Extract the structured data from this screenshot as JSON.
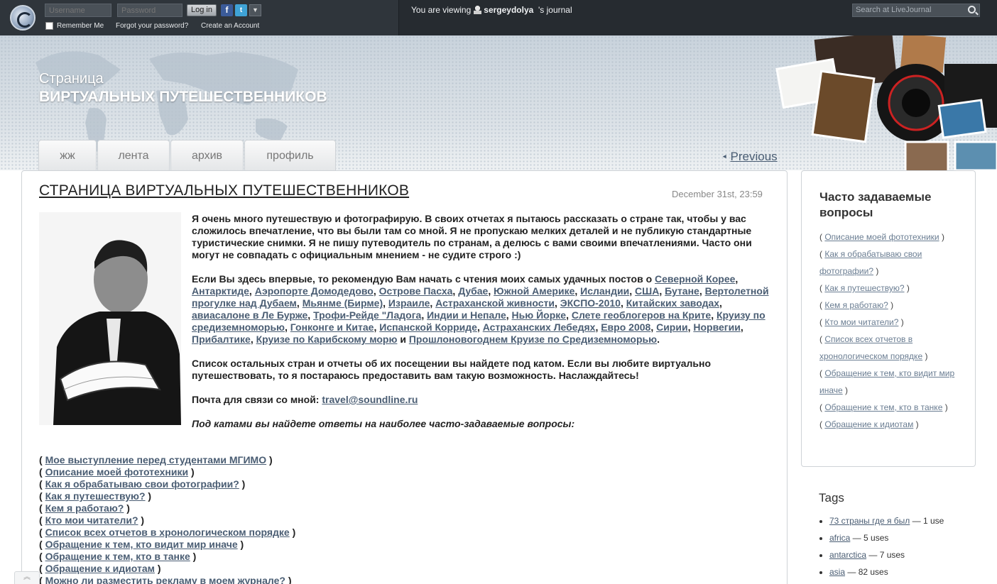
{
  "topbar": {
    "username_placeholder": "Username",
    "password_placeholder": "Password",
    "login_label": "Log in",
    "remember_label": "Remember Me",
    "forgot_label": "Forgot your password?",
    "create_label": "Create an Account",
    "viewing_prefix": "You are viewing",
    "viewing_user": "sergeydolya",
    "viewing_suffix": "'s journal",
    "search_placeholder": "Search at LiveJournal"
  },
  "header": {
    "title_line1": "Страница",
    "title_line2": "ВИРТУАЛЬНЫХ ПУТЕШЕСТВЕННИКОВ"
  },
  "nav": {
    "tabs": [
      "жж",
      "лента",
      "архив",
      "профиль"
    ],
    "previous": "Previous"
  },
  "post": {
    "title": "СТРАНИЦА ВИРТУАЛЬНЫХ ПУТЕШЕСТВЕННИКОВ",
    "date": "December 31st, 23:59",
    "p1": "Я очень много путешествую и фотографирую. В своих отчетах я пытаюсь рассказать о стране так, чтобы у вас сложилось впечатление, что вы были там со мной. Я не пропускаю мелких деталей и не публикую стандартные туристические снимки. Я не пишу путеводитель по странам, а делюсь с вами своими впечатлениями. Часто они могут не совпадать с официальным мнением - не судите строго :)",
    "p2_intro": "Если Вы здесь впервые, то рекомендую Вам начать с чтения моих самых удачных постов о",
    "p2_links": [
      "Северной Корее",
      "Антарктиде",
      "Аэропорте Домодедово",
      "Острове Пасха",
      "Дубае",
      "Южной Америке",
      "Исландии",
      "США",
      "Бутане",
      "Вертолетной прогулке над Дубаем",
      "Мьянме (Бирме)",
      "Израиле",
      "Астраханской живности",
      "ЭКСПО-2010",
      "Китайских заводах",
      "авиасалоне в Ле Бурже",
      "Трофи-Рейде \"Ладога",
      "Индии и Непале",
      "Нью Йорке",
      "Слете геоблогеров на Крите",
      "Круизу по средиземноморью",
      "Гонконге и Китае",
      "Испанской Корриде",
      "Астраханских Лебедях",
      "Евро 2008",
      "Сирии",
      "Норвегии",
      "Прибалтике",
      "Круизе по Карибскому морю",
      "Прошлоновогоднем Круизе по Средиземноморью"
    ],
    "p2_and": "и",
    "p3": "Список остальных стран и отчеты об их посещении вы найдете под катом. Если вы любите виртуально путешествовать, то я постараюсь предоставить вам такую возможность. Наслаждайтесь!",
    "contact_label": "Почта для связи со мной:",
    "contact_email": "travel@soundline.ru",
    "faq_intro": "Под катами вы найдете ответы на наиболее часто-задаваемые вопросы:",
    "faq_items": [
      "Мое выступление перед студентами МГИМО",
      "Описание моей фототехники",
      "Как я обрабатываю свои фотографии?",
      "Как я путешествую?",
      "Кем я работаю?",
      "Кто мои читатели?",
      "Список всех отчетов в хронологическом порядке",
      "Обращение к тем, кто видит мир иначе",
      "Обращение к тем, кто в танке",
      "Обращение к идиотам",
      "Можно ли разместить рекламу в моем журнале?"
    ]
  },
  "sidebar": {
    "faq_heading": "Часто задаваемые вопросы",
    "faq_items": [
      "Описание моей фототехники",
      "Как я обрабатываю свои фотографии?",
      "Как я путешествую?",
      "Кем я работаю?",
      "Кто мои читатели?",
      "Список всех отчетов в хронологическом порядке",
      "Обращение к тем, кто видит мир иначе",
      "Обращение к тем, кто в танке",
      "Обращение к идиотам"
    ],
    "tags_heading": "Tags",
    "tags": [
      {
        "name": "73 страны где я был",
        "count": "1 use"
      },
      {
        "name": "africa",
        "count": "5 uses"
      },
      {
        "name": "antarctica",
        "count": "7 uses"
      },
      {
        "name": "asia",
        "count": "82 uses"
      }
    ]
  },
  "colors": {
    "topbar": "#262b30",
    "link": "#4a5d73",
    "header": "#c9d3dc"
  },
  "icons": [
    "livejournal-logo-icon",
    "facebook-icon",
    "twitter-icon",
    "chevron-down-icon",
    "user-icon",
    "search-icon",
    "arrow-left-icon",
    "scroll-top-icon"
  ]
}
